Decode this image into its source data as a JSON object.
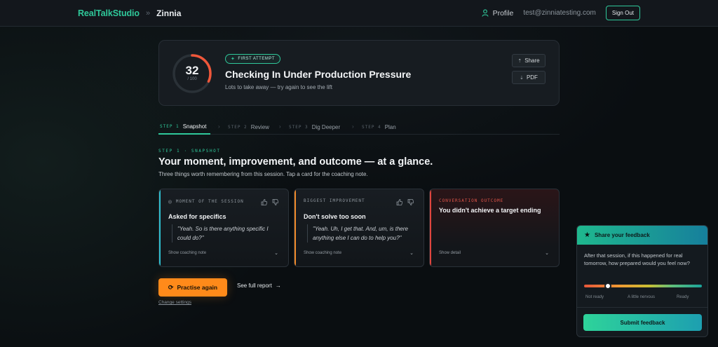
{
  "colors": {
    "brand": "#2fc89a",
    "accent_orange": "#ff8a1a",
    "ring_track": "#2a3137",
    "ring_fill": "#f0573a",
    "card_teal": "#2fbfcf",
    "card_orange": "#f08a2a",
    "card_red": "#e0453e",
    "outcome_label": "#e2554a"
  },
  "header": {
    "brand": "RealTalkStudio",
    "separator": "»",
    "crumb": "Zinnia",
    "profile_icon": "user-icon",
    "profile_label": "Profile",
    "email": "test@zinniatesting.com",
    "sign_out": "Sign Out"
  },
  "hero": {
    "score": "32",
    "score_of": "/ 100",
    "score_value": 32,
    "score_max": 100,
    "badge": "FIRST ATTEMPT",
    "title": "Checking In Under Production Pressure",
    "subtitle": "Lots to take away — try again to see the lift",
    "share_label": "Share",
    "share_icon": "upload-icon",
    "pdf_label": "PDF",
    "pdf_icon": "download-icon"
  },
  "steps": [
    {
      "no": "STEP 1",
      "label": "Snapshot",
      "active": true
    },
    {
      "no": "STEP 2",
      "label": "Review",
      "active": false
    },
    {
      "no": "STEP 3",
      "label": "Dig Deeper",
      "active": false
    },
    {
      "no": "STEP 4",
      "label": "Plan",
      "active": false
    }
  ],
  "section": {
    "eyebrow": "STEP 1 · SNAPSHOT",
    "title": "Your moment, improvement, and outcome — at a glance.",
    "subtitle": "Three things worth remembering from this session. Tap a card for the coaching note."
  },
  "cards": [
    {
      "label": "MOMENT OF THE SESSION",
      "title": "Asked for specifics",
      "quote": "\"Yeah. So is there anything specific I could do?\"",
      "footer": "Show coaching note"
    },
    {
      "label": "BIGGEST IMPROVEMENT",
      "title": "Don't solve too soon",
      "quote": "\"Yeah. Uh, I get that. And, um, is there anything else I can do to help you?\"",
      "footer": "Show coaching note"
    },
    {
      "label": "CONVERSATION OUTCOME",
      "title": "You didn't achieve a target ending",
      "footer": "Show detail"
    }
  ],
  "actions": {
    "practise": "Practise again",
    "full_report": "See full report",
    "full_report_arrow": "→",
    "change_settings": "Change settings"
  },
  "feedback": {
    "title": "Share your feedback",
    "question": "After that session, if this happened for real tomorrow, how prepared would you feel now?",
    "slider_value": 0.2,
    "scale": [
      "Not ready",
      "A little nervous",
      "Ready"
    ],
    "submit": "Submit feedback"
  }
}
